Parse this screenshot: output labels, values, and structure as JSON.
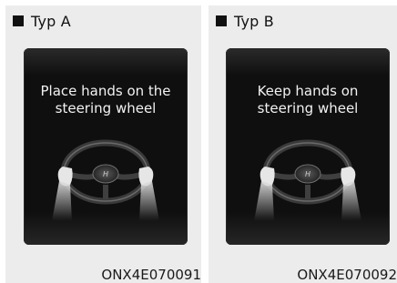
{
  "panels": [
    {
      "title": "Typ A",
      "message": "Place hands on the\nsteering wheel",
      "caption": "ONX4E070091"
    },
    {
      "title": "Typ B",
      "message": "Keep hands on\nsteering wheel",
      "caption": "ONX4E070092"
    }
  ],
  "icons": {
    "header_marker": "square-icon",
    "illustration": "steering-wheel-hands-icon"
  },
  "colors": {
    "panel_background": "#ececec",
    "screen_background": "#0f0f0f",
    "screen_text": "#f2f2f2",
    "header_text": "#111111"
  }
}
